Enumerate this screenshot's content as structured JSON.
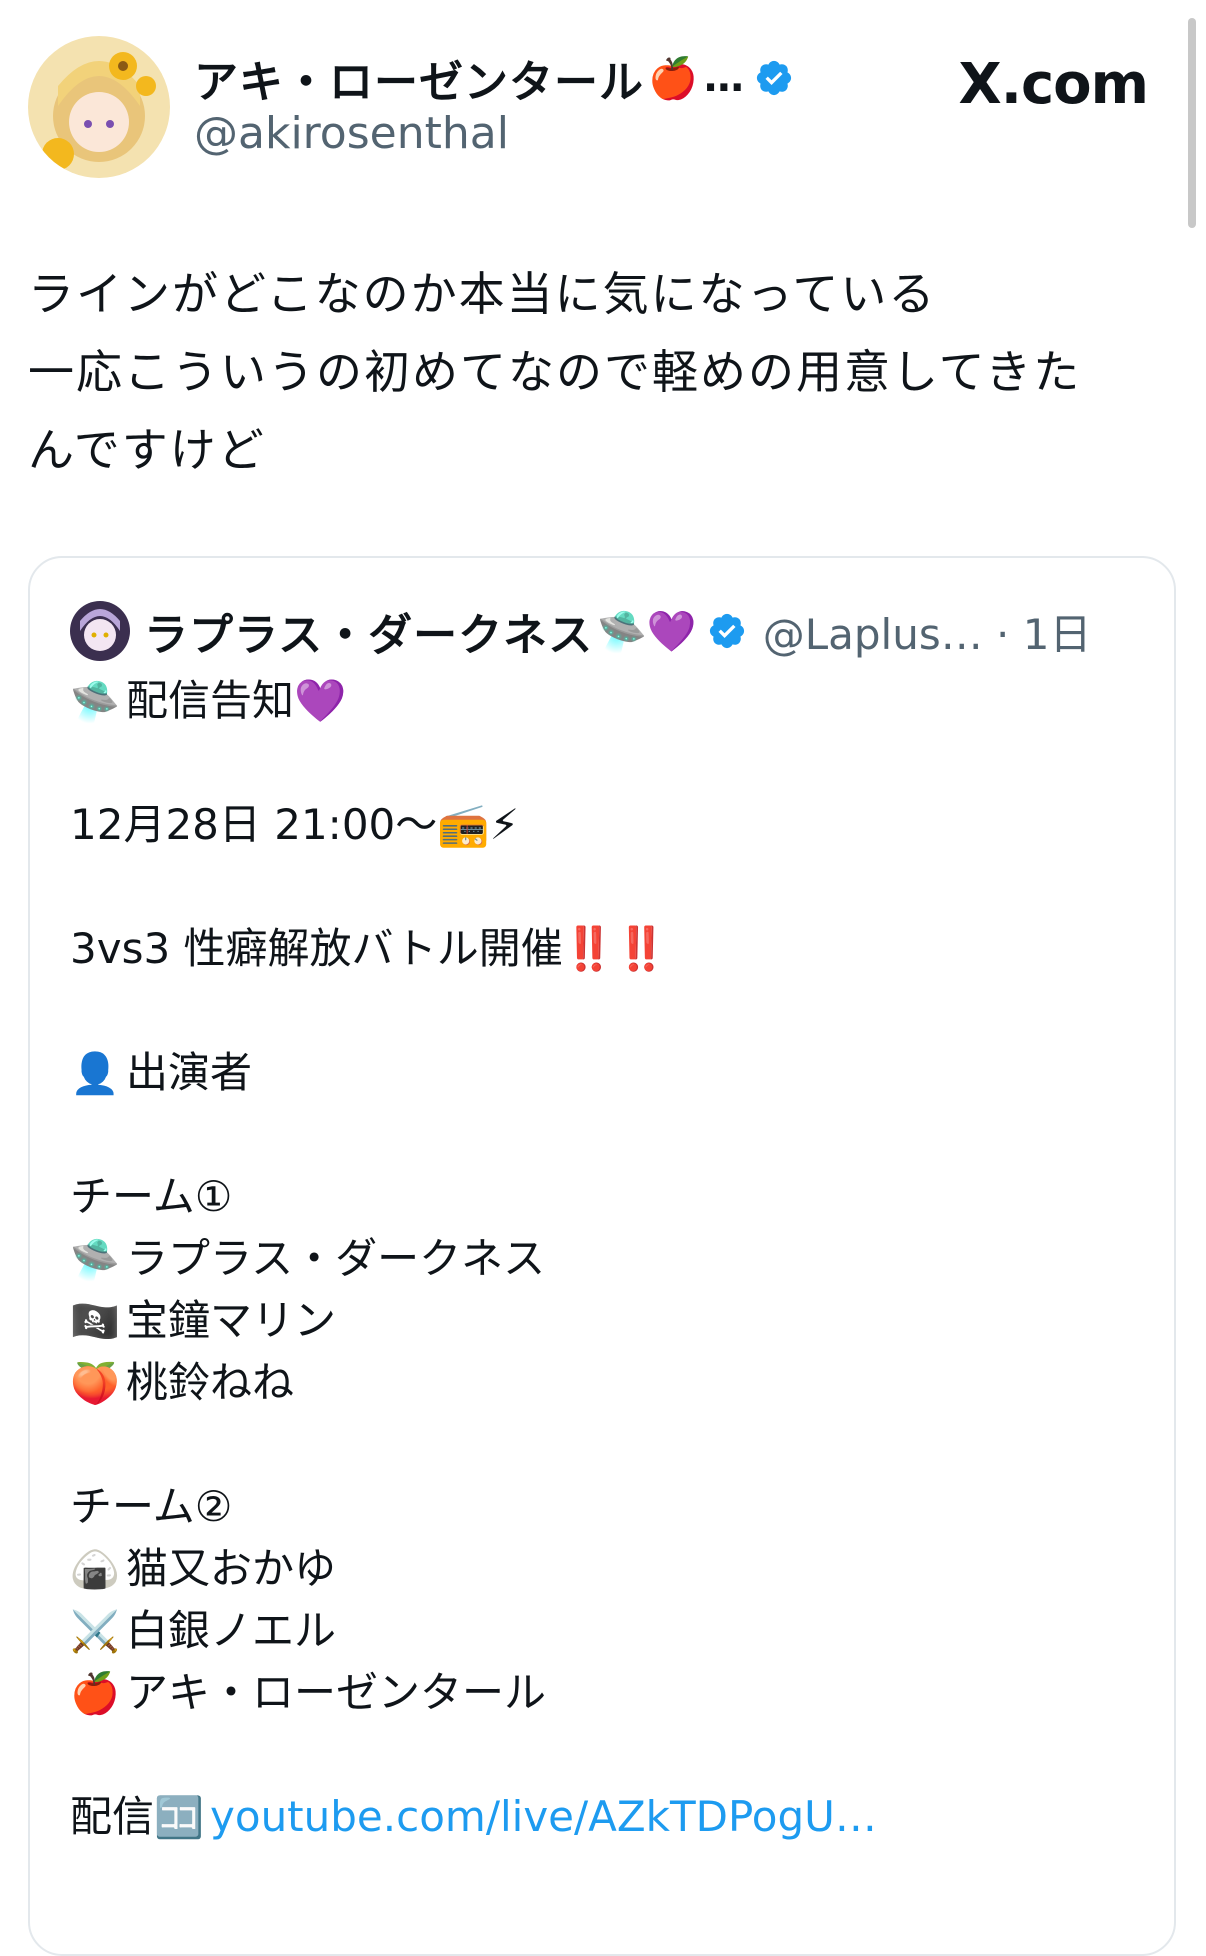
{
  "author": {
    "display_name": "アキ・ローゼンタール",
    "name_emoji": "🍎",
    "ellipsis": "…",
    "handle": "@akirosenthal",
    "verified_icon": "verified-badge-icon"
  },
  "site_label": "X.com",
  "tweet": {
    "lines": [
      "ラインがどこなのか本当に気になっている",
      "一応こういうの初めてなので軽めの用意してきた",
      "んですけど"
    ]
  },
  "quote": {
    "display_name": "ラプラス・ダークネス",
    "name_emojis": "🛸💜",
    "handle_time": "@Laplus… · 1日",
    "body": [
      {
        "emoji": "🛸",
        "text": "配信告知💜"
      },
      {
        "emoji": "",
        "text": ""
      },
      {
        "emoji": "",
        "text": "12月28日 21:00〜📻⚡"
      },
      {
        "emoji": "",
        "text": ""
      },
      {
        "emoji": "",
        "text": "3vs3 性癖解放バトル開催‼️‼️"
      },
      {
        "emoji": "",
        "text": ""
      },
      {
        "emoji": "👤",
        "text": "出演者"
      },
      {
        "emoji": "",
        "text": ""
      },
      {
        "emoji": "",
        "text": "チーム①"
      },
      {
        "emoji": "🛸",
        "text": "ラプラス・ダークネス"
      },
      {
        "emoji": "🏴‍☠️",
        "text": "宝鐘マリン"
      },
      {
        "emoji": "🍑",
        "text": "桃鈴ねね"
      },
      {
        "emoji": "",
        "text": ""
      },
      {
        "emoji": "",
        "text": "チーム②"
      },
      {
        "emoji": "🍙",
        "text": "猫又おかゆ"
      },
      {
        "emoji": "⚔️",
        "text": "白銀ノエル"
      },
      {
        "emoji": "🍎",
        "text": "アキ・ローゼンタール"
      },
      {
        "emoji": "",
        "text": ""
      }
    ],
    "stream_label": "配信",
    "stream_emoji": "🈁",
    "link_text": "youtube.com/live/AZkTDPogU…"
  },
  "colors": {
    "text": "#0f1419",
    "secondary": "#536471",
    "link": "#1d9bf0",
    "verified": "#1d9bf0",
    "border": "#e3e8ec"
  }
}
